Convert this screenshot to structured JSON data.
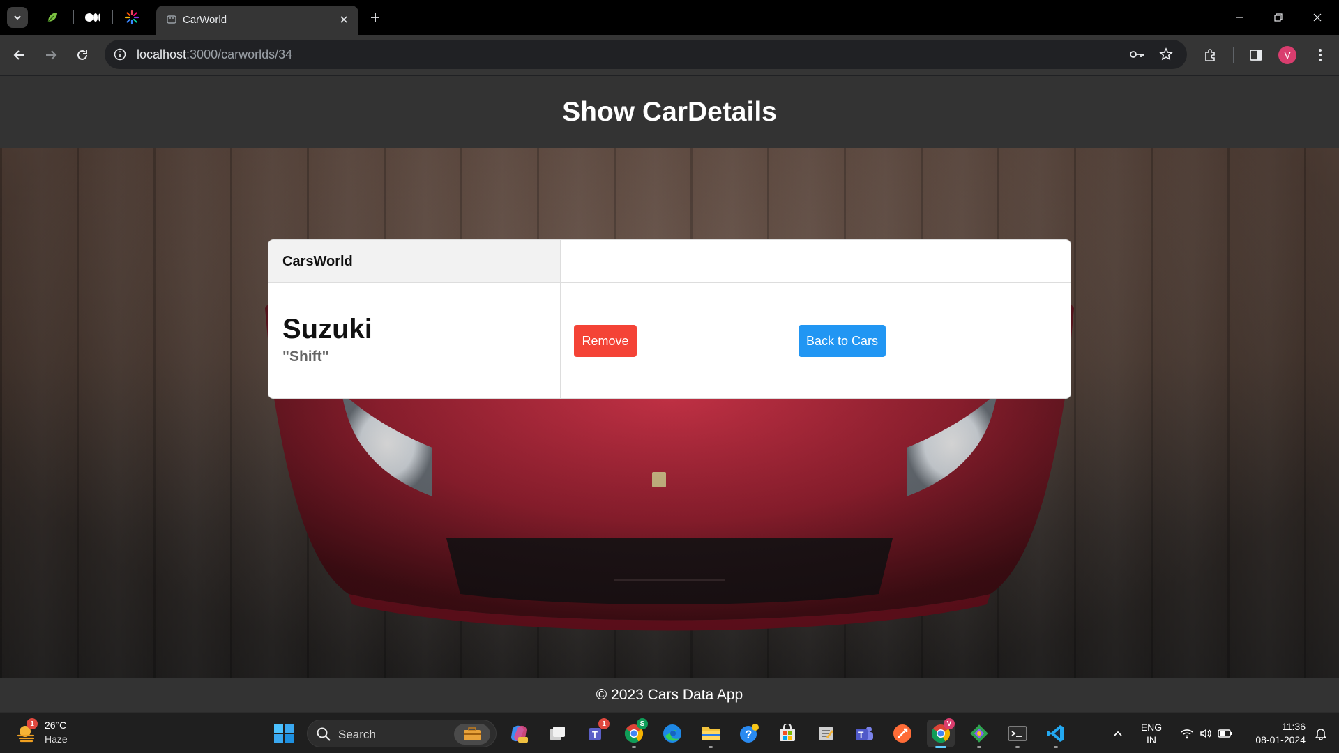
{
  "browser": {
    "tab_title": "CarWorld",
    "url_host": "localhost",
    "url_rest": ":3000/carworlds/34",
    "profile_initial": "V"
  },
  "page": {
    "heading": "Show CarDetails",
    "table": {
      "brand_header": "CarsWorld",
      "make": "Suzuki",
      "model": "\"Shift\"",
      "remove_label": "Remove",
      "back_label": "Back to Cars"
    },
    "footer": "© 2023 Cars Data App"
  },
  "taskbar": {
    "weather_temp": "26°C",
    "weather_cond": "Haze",
    "weather_badge": "1",
    "search_label": "Search",
    "teams_badge": "1",
    "chrome_badge": "S",
    "chrome_profile_badge": "V",
    "lang_line1": "ENG",
    "lang_line2": "IN",
    "time": "11:36",
    "date": "08-01-2024"
  },
  "colors": {
    "remove": "#f44336",
    "back": "#2196f3",
    "header_bg": "#333333"
  }
}
